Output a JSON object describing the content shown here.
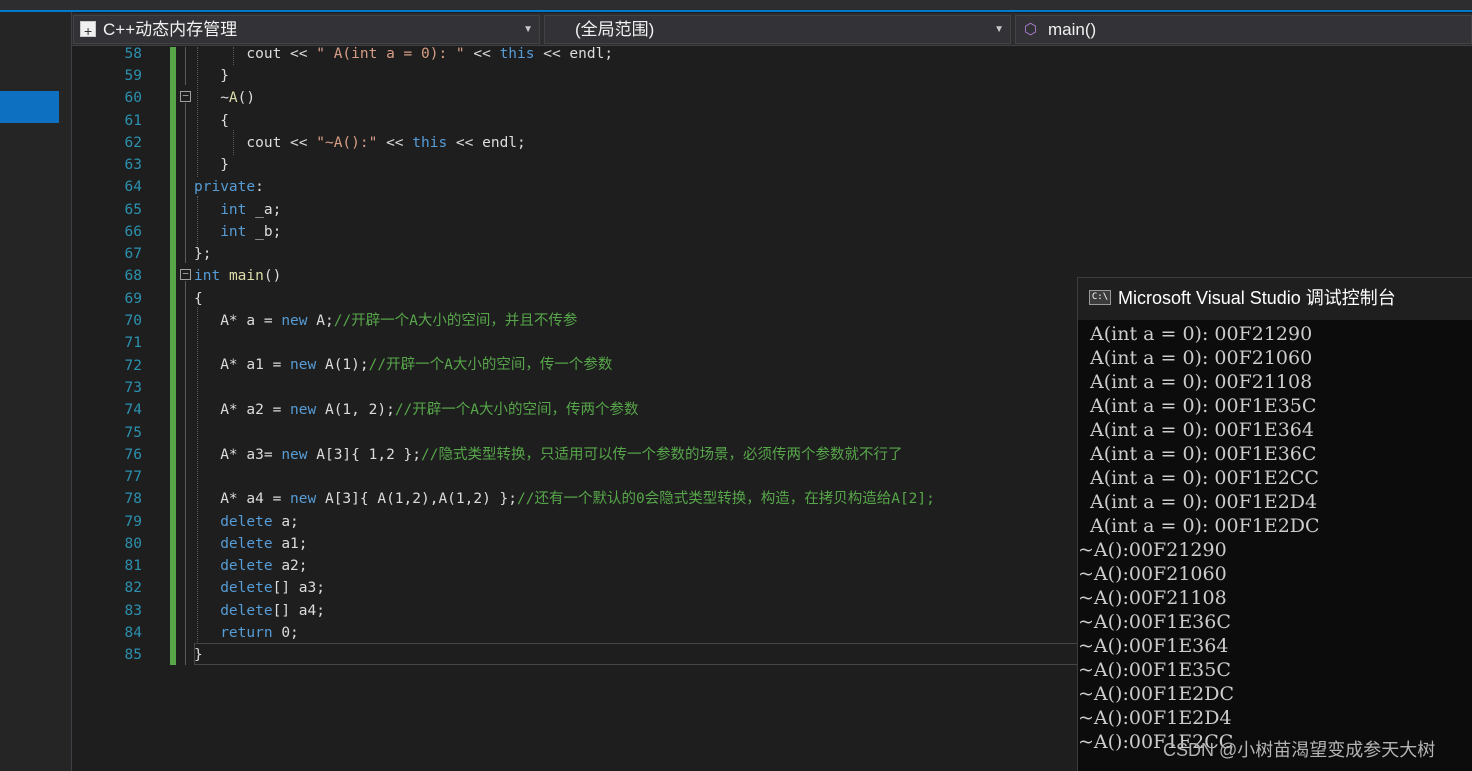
{
  "nav": {
    "project": "C++动态内存管理",
    "scope": "(全局范围)",
    "member": "main()"
  },
  "editor": {
    "line_numbers": [
      "58",
      "59",
      "60",
      "61",
      "62",
      "63",
      "64",
      "65",
      "66",
      "67",
      "68",
      "69",
      "70",
      "71",
      "72",
      "73",
      "74",
      "75",
      "76",
      "77",
      "78",
      "79",
      "80",
      "81",
      "82",
      "83",
      "84",
      "85"
    ],
    "comments": {
      "l70": "//开辟一个A大小的空间，并且不传参",
      "l72": "//开辟一个A大小的空间，传一个参数",
      "l74": "//开辟一个A大小的空间，传两个参数",
      "l76": "//隐式类型转换，只适用可以传一个参数的场景，必须传两个参数就不行了",
      "l78": "//还有一个默认的0会隐式类型转换，构造，在拷贝构造给A[2];"
    },
    "strings": {
      "l58": "\" A(int a = 0): \"",
      "l62": "\"~A():\""
    }
  },
  "console": {
    "title": "Microsoft Visual Studio 调试控制台",
    "icon_text": "C:\\",
    "lines": [
      "A(int a = 0): 00F21290",
      "A(int a = 0): 00F21060",
      "A(int a = 0): 00F21108",
      "A(int a = 0): 00F1E35C",
      "A(int a = 0): 00F1E364",
      "A(int a = 0): 00F1E36C",
      "A(int a = 0): 00F1E2CC",
      "A(int a = 0): 00F1E2D4",
      "A(int a = 0): 00F1E2DC",
      "~A():00F21290",
      "~A():00F21060",
      "~A():00F21108",
      "~A():00F1E36C",
      "~A():00F1E364",
      "~A():00F1E35C",
      "~A():00F1E2DC",
      "~A():00F1E2D4",
      "~A():00F1E2CC"
    ]
  },
  "watermark": "CSDN @小树苗渴望变成参天大树",
  "colors": {
    "keyword": "#569cd6",
    "comment": "#57a64a",
    "string": "#d69d85",
    "line_number": "#2b91af",
    "accent": "#007acc"
  }
}
